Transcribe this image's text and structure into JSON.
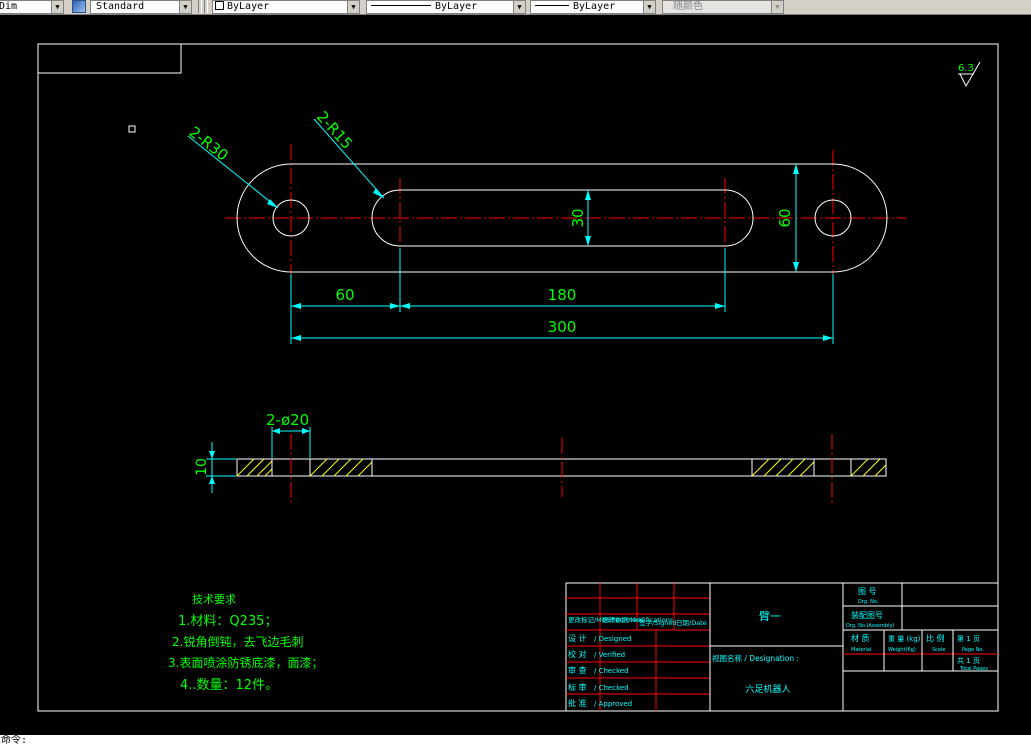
{
  "toolbar": {
    "dimstyle_value": "Dim",
    "textstyle_value": "Standard",
    "layer_value": "ByLayer",
    "linetype_value": "ByLayer",
    "lineweight_value": "ByLayer",
    "plotstyle_value": "随颜色"
  },
  "drawing": {
    "top_view": {
      "radius_label": "2-R30",
      "slot_radius_label": "2-R15",
      "slot_width_dim": "30",
      "height_dim": "60",
      "dim_left": "60",
      "dim_slot_length": "180",
      "dim_overall": "300"
    },
    "side_view": {
      "hole_label": "2-ø20",
      "thickness_dim": "10"
    },
    "roughness_value": "6.3",
    "tech_requirements": {
      "title": "技术要求",
      "items": [
        "1.材料：Q235；",
        "2.锐角倒钝，去飞边毛刺",
        "3.表面喷涂防锈底漆，面漆；",
        "4..数量：12件。"
      ]
    },
    "title_block": {
      "header": [
        "更改标记/Modified mark",
        "更改依据/Modifications",
        "签字/Signed",
        "日期/Date"
      ],
      "rows": [
        {
          "label": "设 计",
          "en": "/ Designed"
        },
        {
          "label": "校 对",
          "en": "/ Verified"
        },
        {
          "label": "审 查",
          "en": "/ Checked"
        },
        {
          "label": "标 审",
          "en": "/ Checked"
        },
        {
          "label": "批 准",
          "en": "/ Approved"
        }
      ],
      "part_name": "臂一",
      "designation_label": "视图名称  / Designation :",
      "product_name": "六足机器人",
      "drawing_no_label": "图 号",
      "drawing_no_en": "Drg. No.",
      "assembly_no_label": "装配图号",
      "assembly_no_en": "Drg. No.(Assembly)",
      "material_label": "材 质",
      "material_en": "Material",
      "weight_label": "重 量 (kg)",
      "weight_en": "Weight(Kg)",
      "scale_label": "比 例",
      "scale_en": "Scale",
      "page_label": "第  1 页",
      "page_en": "Page No.",
      "total_label": "共  1 页",
      "total_en": "Total Pages"
    }
  },
  "command_line": {
    "prompt": "命令:"
  },
  "colors": {
    "background": "#000000",
    "outline": "#ffffff",
    "center_line": "#ff0000",
    "dimension": "#00ffff",
    "dim_text": "#00ff00",
    "hatch": "#ffff00"
  }
}
